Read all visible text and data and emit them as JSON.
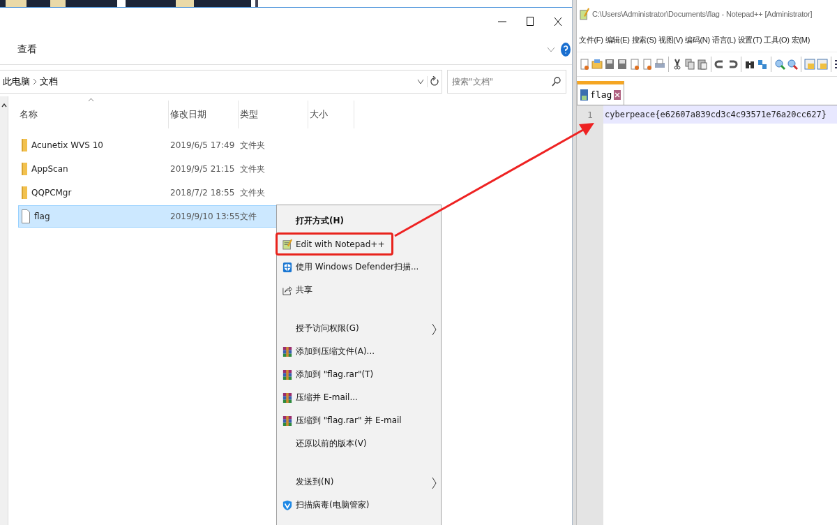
{
  "explorer": {
    "ribbon_tabs": [
      {
        "label": "查看",
        "selected": false
      }
    ],
    "address": {
      "breadcrumb": [
        "此电脑",
        "文档"
      ]
    },
    "search": {
      "placeholder": "搜索\"文档\""
    },
    "columns": [
      "名称",
      "修改日期",
      "类型",
      "大小"
    ],
    "rows": [
      {
        "name": "Acunetix WVS 10",
        "date": "2019/6/5 17:49",
        "type": "文件夹",
        "kind": "folder",
        "selected": false
      },
      {
        "name": "AppScan",
        "date": "2019/9/5 21:15",
        "type": "文件夹",
        "kind": "folder",
        "selected": false
      },
      {
        "name": "QQPCMgr",
        "date": "2018/7/2 18:55",
        "type": "文件夹",
        "kind": "folder",
        "selected": false
      },
      {
        "name": "flag",
        "date": "2019/9/10 13:55",
        "type": "文件",
        "kind": "file",
        "selected": true
      }
    ]
  },
  "context_menu": {
    "items": [
      {
        "kind": "plain",
        "label": "打开方式(H)",
        "bold": true,
        "submenu": false,
        "annotated": false
      },
      {
        "kind": "notepad",
        "label": "Edit with Notepad++",
        "bold": false,
        "submenu": false,
        "annotated": true
      },
      {
        "kind": "defender",
        "label": "使用 Windows Defender扫描...",
        "bold": false,
        "submenu": false,
        "annotated": false
      },
      {
        "kind": "share",
        "label": "共享",
        "bold": false,
        "submenu": false,
        "annotated": false
      },
      {
        "kind": "separator"
      },
      {
        "kind": "plain",
        "label": "授予访问权限(G)",
        "bold": false,
        "submenu": true,
        "annotated": false
      },
      {
        "kind": "archive",
        "label": "添加到压缩文件(A)...",
        "bold": false,
        "submenu": false,
        "annotated": false
      },
      {
        "kind": "archive",
        "label": "添加到 \"flag.rar\"(T)",
        "bold": false,
        "submenu": false,
        "annotated": false
      },
      {
        "kind": "archive",
        "label": "压缩并 E-mail...",
        "bold": false,
        "submenu": false,
        "annotated": false
      },
      {
        "kind": "archive",
        "label": "压缩到 \"flag.rar\" 并 E-mail",
        "bold": false,
        "submenu": false,
        "annotated": false
      },
      {
        "kind": "plain",
        "label": "还原以前的版本(V)",
        "bold": false,
        "submenu": false,
        "annotated": false
      },
      {
        "kind": "separator"
      },
      {
        "kind": "plain",
        "label": "发送到(N)",
        "bold": false,
        "submenu": true,
        "annotated": false
      },
      {
        "kind": "antivirus",
        "label": "扫描病毒(电脑管家)",
        "bold": false,
        "submenu": false,
        "annotated": false
      },
      {
        "kind": "separator"
      }
    ]
  },
  "notepad": {
    "window": {
      "title": "C:\\Users\\Administrator\\Documents\\flag - Notepad++ [Administrator]"
    },
    "menu": [
      "文件(F)",
      "编辑(E)",
      "搜索(S)",
      "视图(V)",
      "编码(N)",
      "语言(L)",
      "设置(T)",
      "工具(O)",
      "宏(M)"
    ],
    "tabs": [
      {
        "label": "flag",
        "selected": true
      }
    ],
    "lines": [
      {
        "number": "1",
        "text": "cyberpeace{e62607a839cd3c4c93571e76a20cc627}",
        "current": true
      }
    ]
  }
}
